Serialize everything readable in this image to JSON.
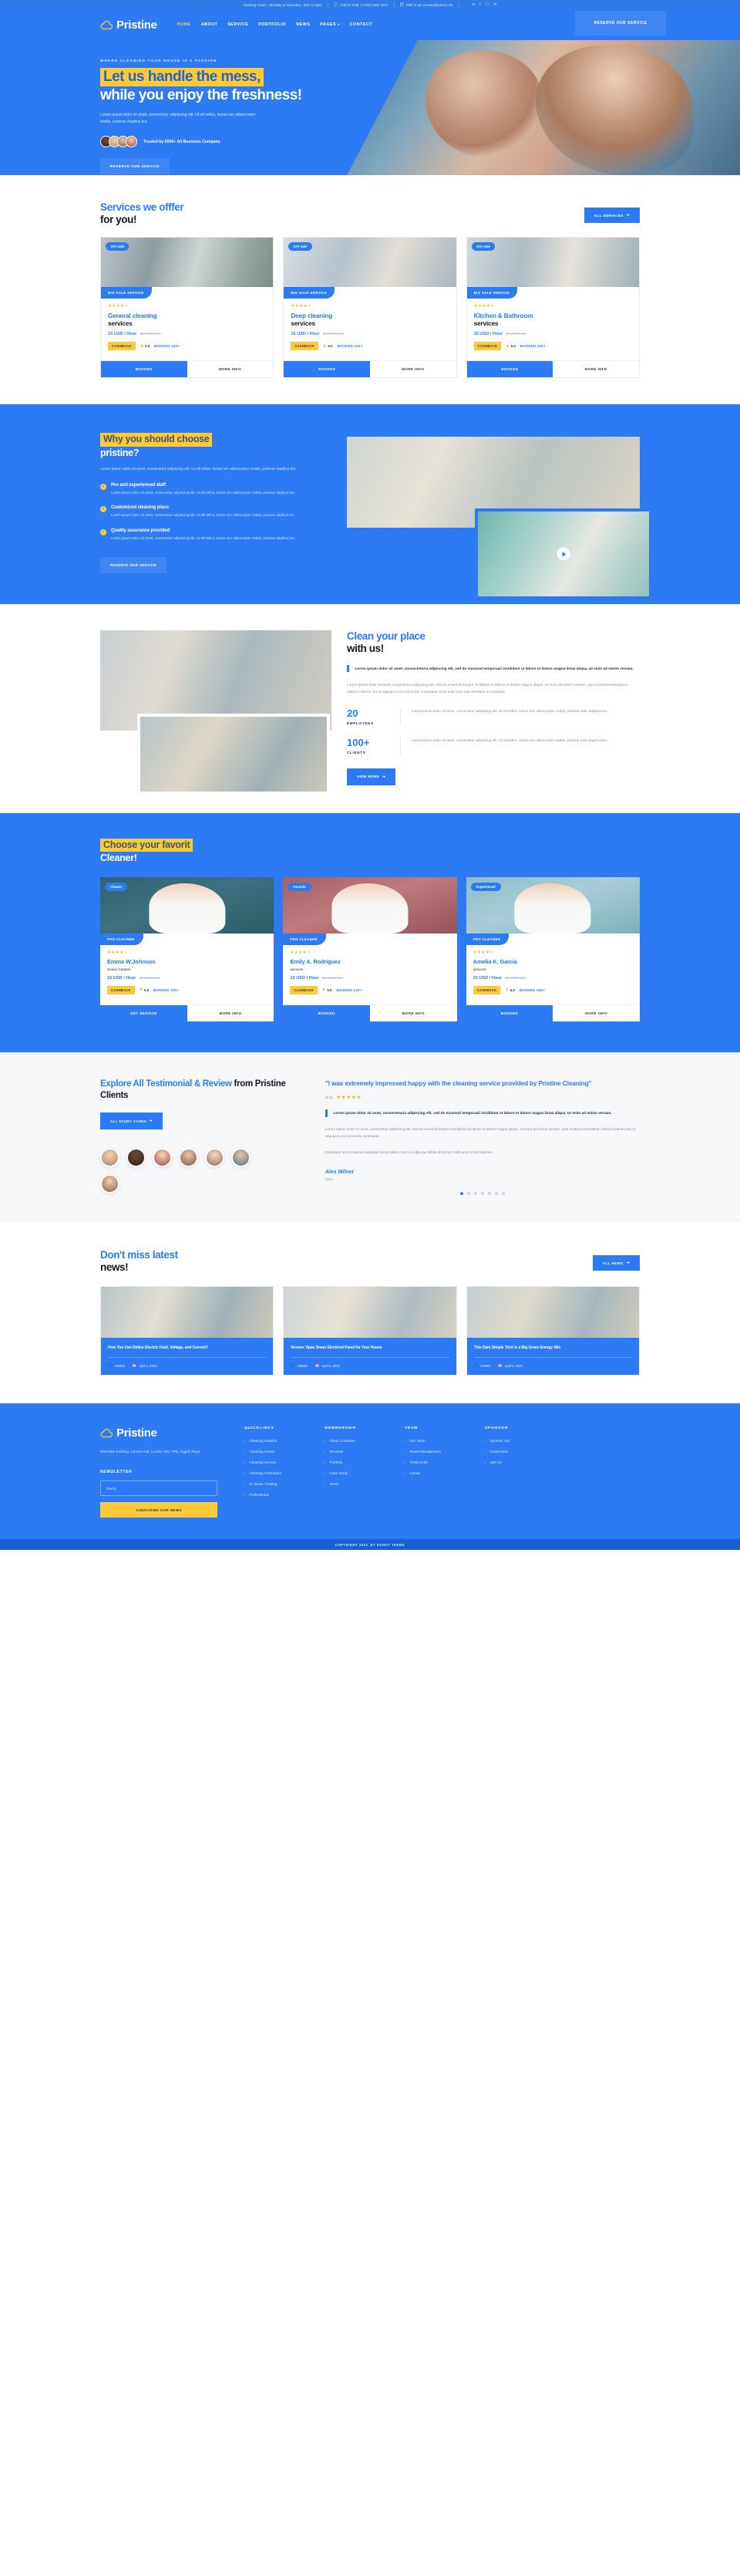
{
  "topbar": {
    "hours": "Opening Hours : Monday to Saturday - 8am to 9pm",
    "phone": "Call for help: (+123) 5462 3257",
    "mail": "Mail to us: envato@gmail.com",
    "social": [
      "twitter-icon",
      "facebook-icon",
      "instagram-icon",
      "linkedin-icon"
    ]
  },
  "nav": {
    "brand": "Pristine",
    "menu": [
      {
        "label": "HOME",
        "active": true
      },
      {
        "label": "ABOUT",
        "active": false
      },
      {
        "label": "SERVICE",
        "active": false
      },
      {
        "label": "PORTFOLIO",
        "active": false
      },
      {
        "label": "NEWS",
        "active": false
      },
      {
        "label": "PAGES",
        "active": false,
        "caret": true
      },
      {
        "label": "CONTACT",
        "active": false
      }
    ],
    "cta": "RESERVE OUR SERVICE"
  },
  "hero": {
    "eyebrow": "WHERE CLEANING YOUR HOUSE IS A PASSION",
    "title_highlight": "Let us handle the mess,",
    "title_rest": "while you enjoy the freshness!",
    "paragraph": "Lorem ipsum dolor sit amet, consectetur adipiscing elit. Ut elit tellus, luctus nec ullamcorper mattis, pulvinar dapibus leo.",
    "trusted": "Trusted by 5000+ All Business Company",
    "cta": "RESERVE OUR SERVICE"
  },
  "services": {
    "title_line1": "Services we offfer",
    "title_line2": "for you!",
    "all_button": "ALL SERVICES",
    "cards": [
      {
        "sale_badge": "10% Sale",
        "category": "BIG SALE SERVICE",
        "stars": "★★★★",
        "title_line1": "General cleaning",
        "title_line2": "services",
        "price": "15 USD / Hour",
        "price_old": "30 USD/Hour",
        "cashback": "CASHBACK",
        "rating": "5.0",
        "booked": "BOOKED 12K+",
        "action_primary": "BOOKED",
        "action_secondary": "MORE INFO"
      },
      {
        "sale_badge": "10% Sale",
        "category": "BIG SALE SERVICE",
        "stars": "★★★★",
        "title_line1": "Deep cleaning",
        "title_line2": "services",
        "price": "15 USD / Hour",
        "price_old": "30 USD/Hour",
        "cashback": "CASHBACK",
        "rating": "5.0",
        "booked": "BOOKED 12K+",
        "action_primary": "BOOKED",
        "action_secondary": "MORE INFO"
      },
      {
        "sale_badge": "10% Sale",
        "category": "BIG SALE SERVICE",
        "stars": "★★★★",
        "title_line1": "Kitchen & Bathroom",
        "title_line2": "services",
        "price": "15 USD / Hour",
        "price_old": "30 USD/Hour",
        "cashback": "CASHBACK",
        "rating": "5.0",
        "booked": "BOOKED 12K+",
        "action_primary": "BOOKED",
        "action_secondary": "MORE INFO"
      }
    ]
  },
  "why": {
    "title_highlight": "Why you should choose",
    "title_rest": "pristine?",
    "paragraph": "Lorem ipsum dolor sit amet, consectetur adipiscing elit. Ut elit tellus, luctus nec ullamcorper mattis, pulvinar dapibus leo.",
    "features": [
      {
        "title": "Pro and experienced staff",
        "desc": "Lorem ipsum dolor sit amet, consectetur adipiscing elit. Ut elit tellus, luctus nec ullamcorper mattis, pulvinar dapibus leo."
      },
      {
        "title": "Customized cleaning plans",
        "desc": "Lorem ipsum dolor sit amet, consectetur adipiscing elit. Ut elit tellus, luctus nec ullamcorper mattis, pulvinar dapibus leo."
      },
      {
        "title": "Quality assurance provided",
        "desc": "Lorem ipsum dolor sit amet, consectetur adipiscing elit. Ut elit tellus, luctus nec ullamcorper mattis, pulvinar dapibus leo."
      }
    ],
    "cta": "RESERVE OUR SERVICE"
  },
  "clean": {
    "title_line1": "Clean your place",
    "title_line2": "with us!",
    "quote": "Lorem ipsum dolor sit amet, consecteturia adipiscing elit, sed do eiusmod temporaaii incididunt ut labore et dolore magna lisnai aliqua. Ut enim ad minim veniam.",
    "paragraph": "Lorem ipsum dolor sit amet, consectetur adipiscing elit, sed do eiusmod tempor incididunt ut labore et dolore magna aliqua. Ut enim ad minim veniam, quis nostrud exercitationi ullamco laboris nisi ut aliquip ex ea commodo consequat. Duis aute irure reprehenderit in voluptate.",
    "stats": [
      {
        "number": "20",
        "label": "EMPLOYEES",
        "desc": "Lorem ipsum dolor sit amet, consectetur adipiscing elit. Ut elit tellus, luctus nec ullamcorper mattis, pulvinar dalin dapibus leo."
      },
      {
        "number": "100+",
        "label": "CLIENTS",
        "desc": "Lorem ipsum dolor sit amet, consectetur adipiscing elit. Ut elit tellus, luctus nec ullamcorper mattis, pulvinar dalin dapibus leo."
      }
    ],
    "cta": "VIEW MORE"
  },
  "cleaners": {
    "title_highlight": "Choose your favorit",
    "title_rest": "Cleaner!",
    "cards": [
      {
        "tag": "Cleaner",
        "category": "PRO CLEANER",
        "stars": "★★★★",
        "name": "Emma W.Johnson",
        "role": "Senior Cleaner",
        "price": "15 USD / Hour",
        "price_old": "30 USD/Hour",
        "cashback": "CASHBACK",
        "rating": "5.0",
        "booked": "BOOKED 12K+",
        "action_primary": "GET SERVICE",
        "action_secondary": "MORE INFO"
      },
      {
        "tag": "Favorite",
        "category": "PRO CLEANER",
        "stars": "★★★★",
        "name": "Emily A. Rodriguez",
        "role": "services",
        "price": "15 USD / Hour",
        "price_old": "30 USD/Hour",
        "cashback": "CASHBACK",
        "rating": "5.0",
        "booked": "BOOKED 12K+",
        "action_primary": "BOOKED",
        "action_secondary": "MORE INFO"
      },
      {
        "tag": "Experienced",
        "category": "PRO CLEANER",
        "stars": "★★★★",
        "name": "Amelia K. Garcia",
        "role": "services",
        "price": "15 USD / Hour",
        "price_old": "30 USD/Hour",
        "cashback": "CASHBACK",
        "rating": "5.0",
        "booked": "BOOKED 12K+",
        "action_primary": "BOOKED",
        "action_secondary": "MORE INFO"
      }
    ]
  },
  "testimonial": {
    "title_a": "Explore All Testimonial &",
    "title_b": "Review",
    "title_c": " from Pristine Clients",
    "cta": "ALL STUDY CASES",
    "quote": "\"I was extremely impressed happy with the cleaning service provided by Pristine Cleaning\"",
    "rating_label": "(5.0)",
    "stars": "★★★★★",
    "bold_paragraph": "Lorem ipsum dolor sit amet, consecteturia adipiscing elit, sed do eiusmod temporaaii incididunt ut labore et dolore magna lisnai aliqua. Ut enim ad minim veniam.",
    "paragraph1": "Lorem ipsum dolor sit amet, consectetur adipiscing elit, sed do eiusmod tempor incididunt uti labore et dolore magna aliqua. Ut enim ad minim veniam, quis nostrud exercitation ullamco laboris nisi ut aliquip ex ea commodo consequat.",
    "paragraph2": "Excepteur sint occaecat cupidatat non proident, sunt in culpa qui officia deserunt mollit anim id est laborum.",
    "author": "Alex Milner",
    "author_role": "CEO"
  },
  "news": {
    "title_line1": "Don't miss latest",
    "title_line2": "news!",
    "all_button": "ALL NEWS",
    "cards": [
      {
        "title": "How You Can Define Electric Field, Voltage, and Current?",
        "author": "ADMIN",
        "date": "April 5, 2023"
      },
      {
        "title": "Review: Spax Smart Electrical Panel for Your House",
        "author": "ADMIN",
        "date": "April 5, 2023"
      },
      {
        "title": "This Dam Simple Trick Is a Big Green Energy Win",
        "author": "ADMIN",
        "date": "April 5, 2023"
      }
    ]
  },
  "footer": {
    "brand": "Pristine",
    "address": "Riverside Building, County Hall, London SE1 7PB, Inggris Raya",
    "newsletter_label": "NEWSLETTER",
    "email_placeholder": "EMAIL",
    "email_value": "",
    "subscribe": "SUBSCRIBE OUR NEWS",
    "columns": [
      {
        "heading": "QUICKLINKS",
        "items": [
          "Cleaning Solution",
          "Cleaning House",
          "Cleaning Service",
          "Cleaning Consultant",
          "In House Training",
          "Professional"
        ]
      },
      {
        "heading": "MEMBERSHIP",
        "items": [
          "About Company",
          "Services",
          "Portfolio",
          "Case Study",
          "News"
        ]
      },
      {
        "heading": "TEAM",
        "items": [
          "Our Team",
          "Board Management",
          "Testimonial",
          "Career"
        ]
      },
      {
        "heading": "SPONSOR",
        "items": [
          "Sponsor List",
          "Corporation",
          "Join Us"
        ]
      }
    ],
    "copyright": "COPYRIGHT 2023. BY EGHOT THEME"
  },
  "colors": {
    "brand_blue": "#2d7bf4",
    "accent_yellow": "#ffc938",
    "dark": "#16181d",
    "muted": "#8a939f"
  }
}
